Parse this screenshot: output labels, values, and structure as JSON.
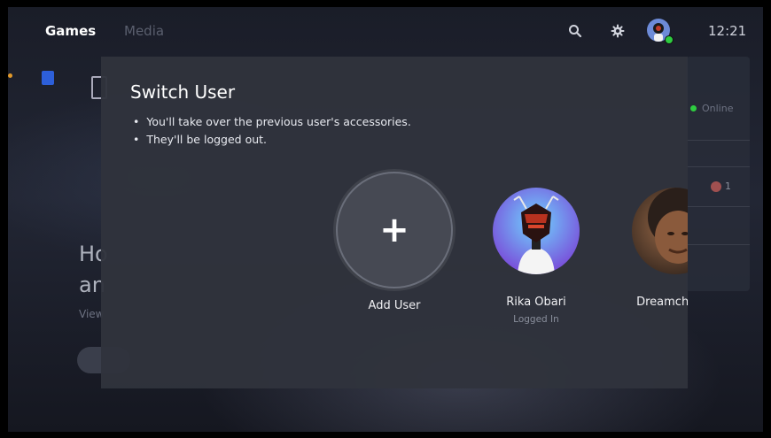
{
  "topbar": {
    "tabs": [
      "Games",
      "Media"
    ],
    "active_tab": "Games",
    "clock": "12:21",
    "icons": [
      "search-icon",
      "gear-icon",
      "profile-avatar"
    ]
  },
  "background": {
    "headline_line1": "Ho",
    "headline_line2": "an",
    "link_text": "View"
  },
  "side_panel": {
    "status": "Online",
    "trophy_count": "1"
  },
  "modal": {
    "title": "Switch User",
    "bullets": [
      "You'll take over the previous user's accessories.",
      "They'll be logged out."
    ],
    "users": [
      {
        "name": "Add User",
        "status": "",
        "icon": "plus-icon"
      },
      {
        "name": "Rika Obari",
        "status": "Logged In"
      },
      {
        "name": "Dreamchild C",
        "status": ""
      }
    ]
  },
  "colors": {
    "online": "#2ecc40",
    "modal_bg": "#30333c",
    "accent_blue": "#2d5fd9"
  }
}
